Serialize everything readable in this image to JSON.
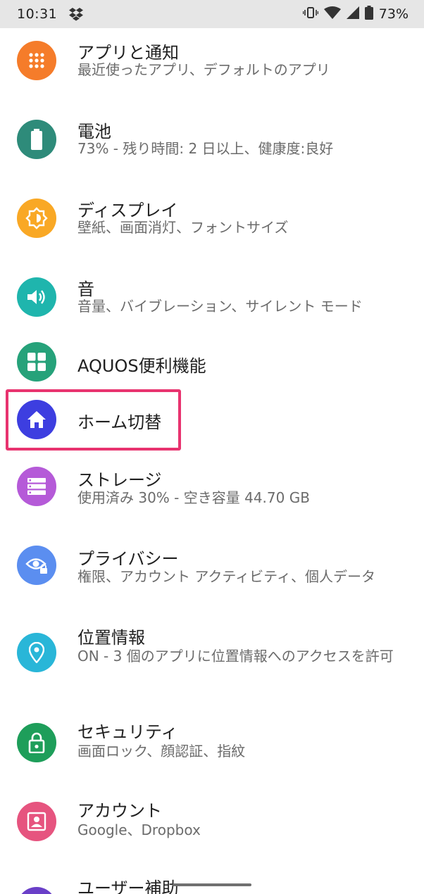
{
  "status_bar": {
    "time": "10:31",
    "battery": "73%"
  },
  "items": [
    {
      "title": "アプリと通知",
      "subtitle": "最近使ったアプリ、デフォルトのアプリ",
      "color": "#f57c2a",
      "icon": "apps-grid-icon"
    },
    {
      "title": "電池",
      "subtitle": "73% - 残り時間: 2 日以上、健康度:良好",
      "color": "#2e8b7a",
      "icon": "battery-icon"
    },
    {
      "title": "ディスプレイ",
      "subtitle": "壁紙、画面消灯、フォントサイズ",
      "color": "#f9a825",
      "icon": "brightness-icon"
    },
    {
      "title": "音",
      "subtitle": "音量、バイブレーション、サイレント モード",
      "color": "#1fb5ad",
      "icon": "volume-icon"
    },
    {
      "title": "AQUOS便利機能",
      "subtitle": "",
      "color": "#26a27a",
      "icon": "dashboard-icon"
    },
    {
      "title": "ホーム切替",
      "subtitle": "",
      "color": "#3d3ee0",
      "icon": "home-icon"
    },
    {
      "title": "ストレージ",
      "subtitle": "使用済み 30% - 空き容量 44.70 GB",
      "color": "#b55ad8",
      "icon": "storage-icon"
    },
    {
      "title": "プライバシー",
      "subtitle": "権限、アカウント アクティビティ、個人データ",
      "color": "#5b8ef0",
      "icon": "privacy-eye-icon"
    },
    {
      "title": "位置情報",
      "subtitle": "ON - 3 個のアプリに位置情報へのアクセスを許可",
      "color": "#29b6d8",
      "icon": "location-pin-icon"
    },
    {
      "title": "セキュリティ",
      "subtitle": "画面ロック、顔認証、指紋",
      "color": "#1e9e5a",
      "icon": "lock-icon"
    },
    {
      "title": "アカウント",
      "subtitle": "Google、Dropbox",
      "color": "#e6547f",
      "icon": "account-icon"
    },
    {
      "title": "ユーザー補助",
      "subtitle": "",
      "color": "#6a3fc8",
      "icon": "accessibility-icon"
    }
  ]
}
